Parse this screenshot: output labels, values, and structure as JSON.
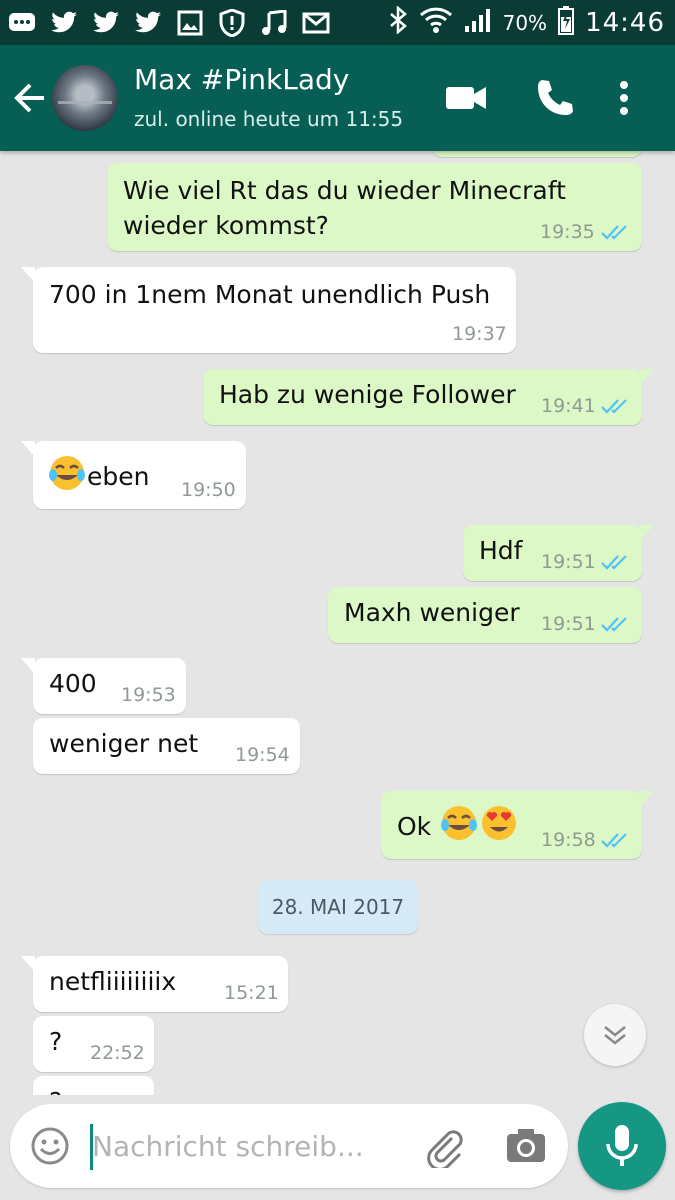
{
  "status_bar": {
    "icons": [
      "chat-bubble-icon",
      "twitter-bird-icon",
      "twitter-bird-icon",
      "twitter-bird-icon",
      "gallery-icon",
      "alert-shield-icon",
      "music-note-icon",
      "mail-icon"
    ],
    "system_icons": [
      "bluetooth-icon",
      "wifi-icon",
      "signal-icon",
      "battery-charging-icon"
    ],
    "battery": "70%",
    "time": "14:46"
  },
  "header": {
    "contact_name": "Max #PinkLady",
    "last_seen": "zul. online heute um 11:55",
    "icons": [
      "back-arrow-icon",
      "video-call-icon",
      "phone-icon",
      "more-vert-icon"
    ]
  },
  "messages": [
    {
      "dir": "out",
      "text_line1": "Wie viel Rt das du wieder Minecraft",
      "text_line2": "wieder kommst?",
      "time": "19:35",
      "read": true
    },
    {
      "dir": "in",
      "text": "700 in 1nem Monat unendlich Push",
      "time": "19:37"
    },
    {
      "dir": "out",
      "text": "Hab zu wenige Follower",
      "time": "19:41",
      "read": true
    },
    {
      "dir": "in",
      "emoji": "face-with-tears-of-joy",
      "text": "eben",
      "time": "19:50"
    },
    {
      "dir": "out",
      "text": "Hdf",
      "time": "19:51",
      "read": true
    },
    {
      "dir": "out",
      "text": "Maxh weniger",
      "time": "19:51",
      "read": true
    },
    {
      "dir": "in",
      "text": "400",
      "time": "19:53"
    },
    {
      "dir": "in",
      "text": "weniger net",
      "time": "19:54"
    },
    {
      "dir": "out",
      "text": "Ok",
      "emojis": [
        "face-with-tears-of-joy",
        "heart-eyes"
      ],
      "time": "19:58",
      "read": true
    },
    {
      "dir": "in",
      "text": "netfliiiiiiiix",
      "time": "15:21"
    },
    {
      "dir": "in",
      "text": "?",
      "time": "22:52"
    },
    {
      "dir": "in",
      "text": "?",
      "time": ""
    }
  ],
  "date_divider": "28. MAI 2017",
  "colors": {
    "header": "#075e54",
    "status_bar": "#0a3c35",
    "outgoing": "#dcf8c6",
    "incoming": "#ffffff",
    "read_ticks": "#4fc3f7",
    "fab": "#169784"
  },
  "composer": {
    "placeholder": "Nachricht schreib...",
    "value": ""
  }
}
